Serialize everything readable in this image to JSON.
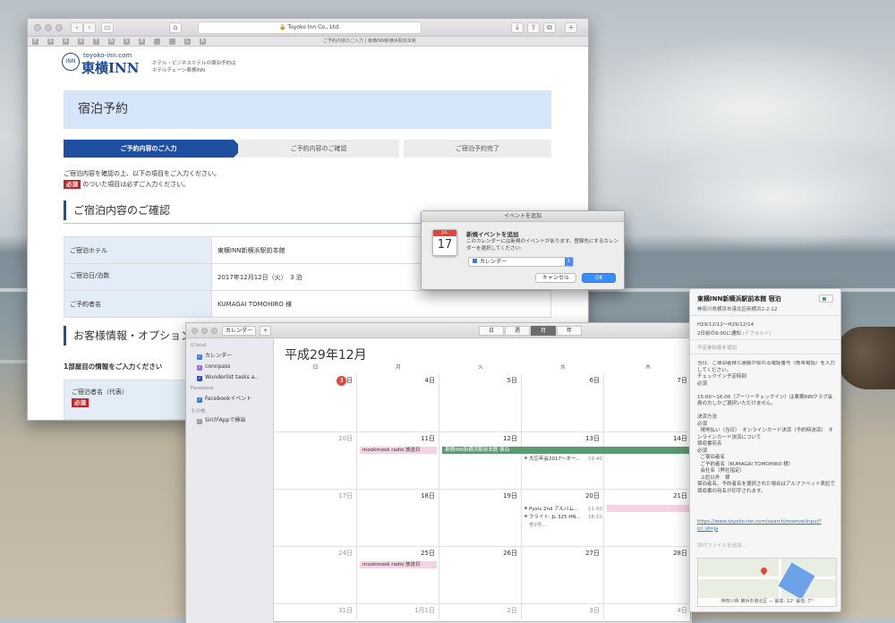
{
  "browser": {
    "url_host": "Toyoko Inn Co., Ltd.",
    "tab_title": "ご予約内容のご入力 | 東横INN新横浜駅前本館",
    "favorites": [
      "E",
      "G",
      "A",
      "G",
      "T",
      "B",
      "S",
      "B",
      "",
      "",
      "L",
      "B"
    ],
    "logo_url": "toyoko-inn.com",
    "logo_brand": "東横INN",
    "logo_tag1": "ホテル・ビジネスホテルの宿泊予約は",
    "logo_tag2": "ホテルチェーン東横INN",
    "hero": "宿泊予約",
    "steps": [
      "ご予約内容のご入力",
      "ご予約内容のご確認",
      "ご宿泊予約完了"
    ],
    "intro_line1": "ご宿泊内容を確認の上、以下の項目をご入力ください。",
    "required_badge": "必須",
    "intro_line2": "のついた項目は必ずご入力ください。",
    "section1": "ご宿泊内容のご確認",
    "rows": [
      {
        "label": "ご宿泊ホテル",
        "value": "東横INN新横浜駅前本館"
      },
      {
        "label": "ご宿泊日/泊数",
        "value": "2017年12月12日（火）　3 泊"
      },
      {
        "label": "ご予約者名",
        "value": "KUMAGAI TOMOHIRO 様"
      }
    ],
    "section2": "お客様情報・オプションの",
    "subhead": "1部屋目の情報をご入力ください",
    "rep_label": "ご宿泊者名（代表）",
    "rep_badge": "必須"
  },
  "dialog": {
    "title": "イベントを追加",
    "icon_month": "JUL",
    "icon_day": "17",
    "heading": "新規イベントを追加",
    "text": "このカレンダーには新規のイベントがあります。登録先にするカレンダーを選択してください:",
    "select_value": "カレンダー",
    "cancel": "キャンセル",
    "ok": "OK"
  },
  "calendar": {
    "toolbar_calendars": "カレンダー",
    "toolbar_add": "+",
    "views": [
      "日",
      "週",
      "月",
      "年"
    ],
    "active_view": "月",
    "month_title": "平成29年12月",
    "sidebar": {
      "icloud": "iCloud",
      "items": [
        {
          "label": "カレンダー",
          "color": "#3e7bd6"
        },
        {
          "label": "connpass",
          "color": "#9b6ad6"
        },
        {
          "label": "Wunderlist tasks a..",
          "color": "#2a4fa8"
        }
      ],
      "facebook": "Facebook",
      "fb_items": [
        {
          "label": "Facebookイベント",
          "color": "#3e7bd6"
        }
      ],
      "other": "その他",
      "other_items": [
        {
          "label": "SiriがAppで検出",
          "color": "#9b9b9b"
        }
      ]
    },
    "weekdays": [
      "日",
      "月",
      "火",
      "水",
      "木"
    ],
    "weeks": [
      [
        "3日",
        "4日",
        "5日",
        "6日",
        "7日"
      ],
      [
        "10日",
        "11日",
        "12日",
        "13日",
        "14日"
      ],
      [
        "17日",
        "18日",
        "19日",
        "20日",
        "21日"
      ],
      [
        "24日",
        "25日",
        "26日",
        "27日",
        "28日"
      ],
      [
        "31日",
        "1月1日",
        "2日",
        "3日",
        "4日"
      ]
    ],
    "events": {
      "mookmook1": "mookmook radio 放送日",
      "hotel": "東横INN新横浜駅前本館 宿泊",
      "bonenkai": "大忘年会2017〜オー...",
      "bonenkai_time": "19:40",
      "pyxis": "Pyxis 2nd アルバム...",
      "pyxis_time": "11:00",
      "flight": "フライト: JL 325 HN...",
      "flight_time": "18:10",
      "more": "他2件...",
      "mookmook2": "mookmook radio 放送日"
    }
  },
  "popover": {
    "title": "東横INN新横浜駅前本館 宿泊",
    "address": "神奈川県横浜市港北区新横浜2-2-12",
    "dates": "H29/12/12〜H29/12/14",
    "alert": "2日前の9:00に通知",
    "alert_default": "(デフォルト)",
    "invitees": "予定参加者を追加",
    "notes": "当日、ご宿泊者様と連絡が取れる電話番号（携帯電話）を入力してください。\nチェックイン予定時刻\n必須\n\n15:00〜16:00（アーリーチェックイン）は東横INNクラブ会員の方しかご選択いただけません。\n\n決済方法\n必須\n  現地払い（当日）　オンラインカード決済（予約時決済）　オンラインカード決済について\n領収書宛名\n必須\n  ご宿泊者名\n  ご予約者名（KUMAGAI TOMOHIRO 様）\n  会社名（弊社指定）\n  上記以外　様\n宿泊者名、予約者名を選択された場合はアルファベット表記で領収書の宛名が印字されます。",
    "link": "https://www.toyoko-inn.com/search/reserve/input?icl_id=ja",
    "attach": "添付ファイルを追加...",
    "map_caption": "神奈川県 横浜市港北区 — 最高: 12° 最低: 7°"
  }
}
